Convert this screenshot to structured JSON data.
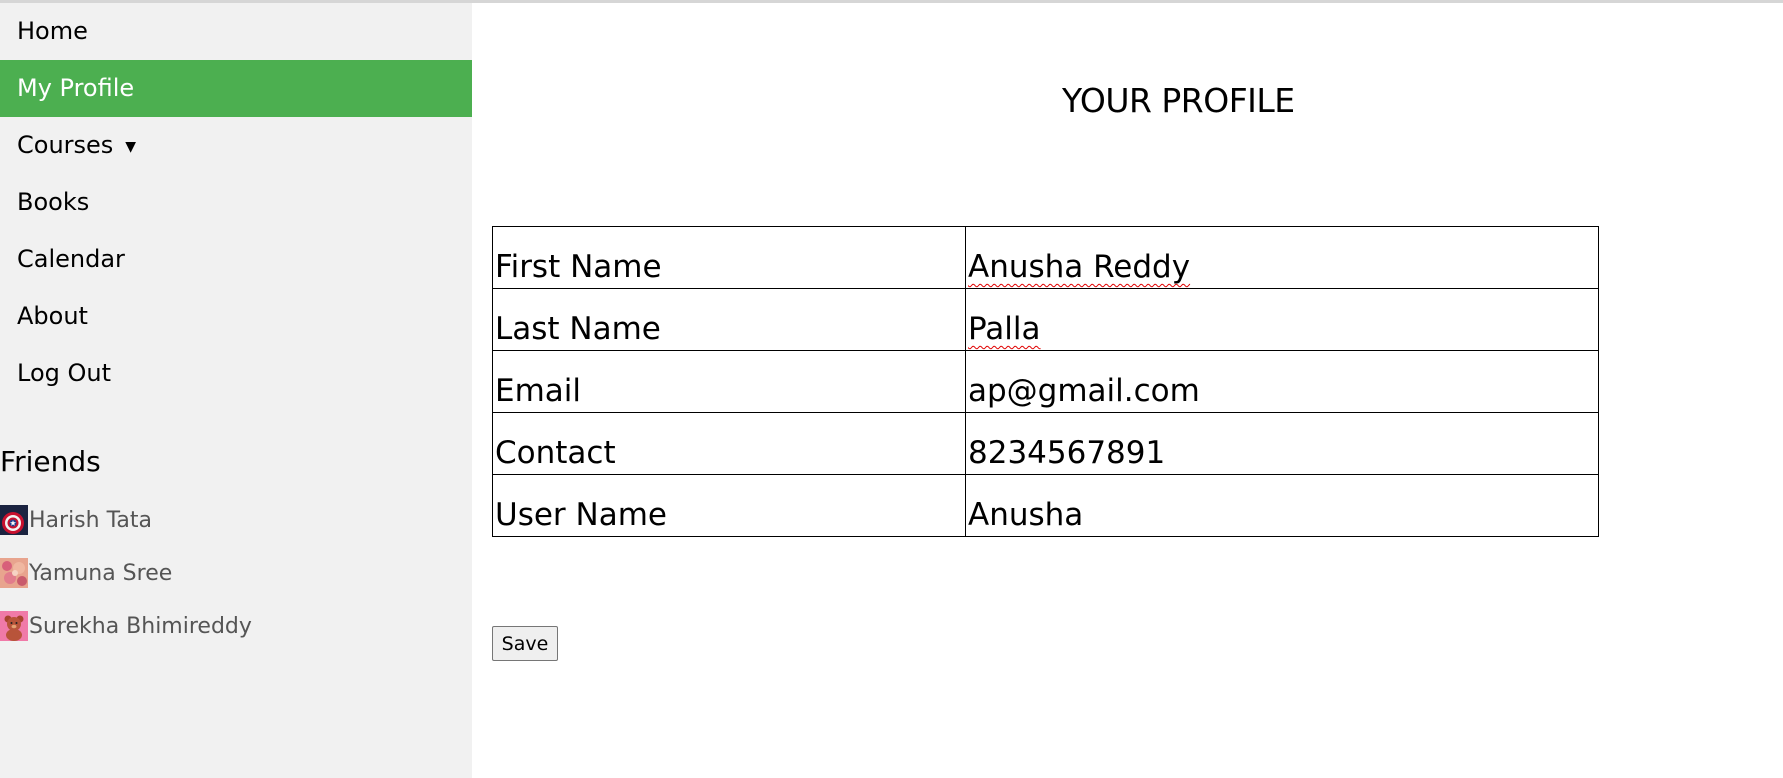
{
  "sidebar": {
    "nav": [
      {
        "label": "Home",
        "active": false
      },
      {
        "label": "My Profile",
        "active": true
      },
      {
        "label": "Courses",
        "active": false,
        "has_dropdown": true,
        "dropdown_icon": "caret-down-icon"
      },
      {
        "label": "Books",
        "active": false
      },
      {
        "label": "Calendar",
        "active": false
      },
      {
        "label": "About",
        "active": false
      },
      {
        "label": "Log Out",
        "active": false
      }
    ],
    "friends_title": "Friends",
    "friends": [
      {
        "name": "Harish Tata",
        "avatar": "captain-america-shield-avatar"
      },
      {
        "name": "Yamuna Sree",
        "avatar": "flowers-avatar"
      },
      {
        "name": "Surekha Bhimireddy",
        "avatar": "teddy-bear-avatar"
      }
    ]
  },
  "main": {
    "title": "YOUR PROFILE",
    "profile_rows": [
      {
        "label": "First Name",
        "value": "Anusha Reddy"
      },
      {
        "label": "Last Name",
        "value": "Palla"
      },
      {
        "label": "Email",
        "value": "ap@gmail.com"
      },
      {
        "label": "Contact",
        "value": "8234567891"
      },
      {
        "label": "User Name",
        "value": "Anusha"
      }
    ],
    "save_label": "Save"
  },
  "colors": {
    "sidebar_bg": "#f1f1f1",
    "active_nav_bg": "#4caf50",
    "active_nav_text": "#ffffff",
    "friend_name_text": "#555555",
    "spellcheck_underline": "#e00000"
  }
}
